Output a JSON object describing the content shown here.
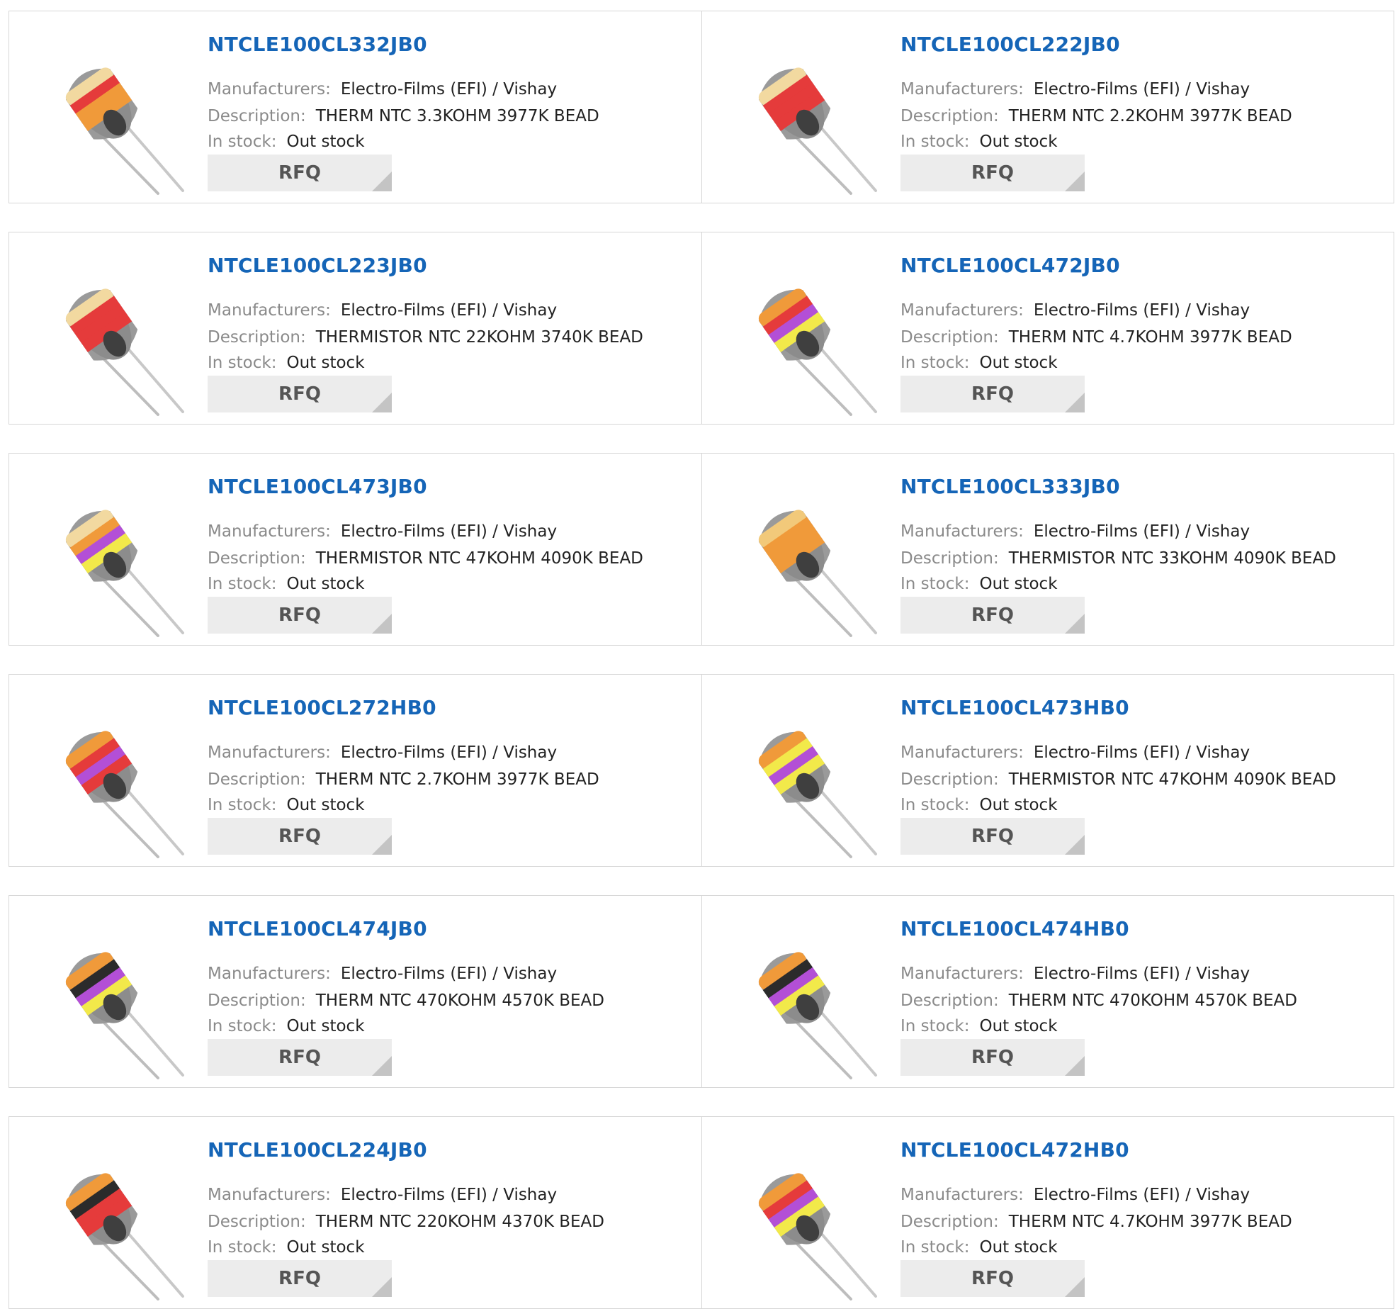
{
  "labels": {
    "manufacturers": "Manufacturers:",
    "description": "Description:",
    "in_stock": "In stock:",
    "rfq": "RFQ"
  },
  "colors": {
    "title_link": "#1565b7",
    "border": "#d6d6d6",
    "rfq_bg": "#ececec"
  },
  "products": [
    {
      "part": "NTCLE100CL332JB0",
      "manufacturer": "Electro-Films (EFI) / Vishay",
      "description": "THERM NTC 3.3KOHM 3977K BEAD",
      "stock": "Out stock",
      "bands": [
        "#f2d9a0",
        "#e53b3b",
        "#f09a3a",
        "#f09a3a"
      ]
    },
    {
      "part": "NTCLE100CL222JB0",
      "manufacturer": "Electro-Films (EFI) / Vishay",
      "description": "THERM NTC 2.2KOHM 3977K BEAD",
      "stock": "Out stock",
      "bands": [
        "#f2d9a0",
        "#e53b3b",
        "#e53b3b",
        "#e53b3b"
      ]
    },
    {
      "part": "NTCLE100CL223JB0",
      "manufacturer": "Electro-Films (EFI) / Vishay",
      "description": "THERMISTOR NTC 22KOHM 3740K BEAD",
      "stock": "Out stock",
      "bands": [
        "#f2d9a0",
        "#e53b3b",
        "#e53b3b",
        "#e53b3b"
      ]
    },
    {
      "part": "NTCLE100CL472JB0",
      "manufacturer": "Electro-Films (EFI) / Vishay",
      "description": "THERM NTC 4.7KOHM 3977K BEAD",
      "stock": "Out stock",
      "bands": [
        "#f09a3a",
        "#e53b3b",
        "#b34fd6",
        "#f2e94a"
      ]
    },
    {
      "part": "NTCLE100CL473JB0",
      "manufacturer": "Electro-Films (EFI) / Vishay",
      "description": "THERMISTOR NTC 47KOHM 4090K BEAD",
      "stock": "Out stock",
      "bands": [
        "#f2d9a0",
        "#f09a3a",
        "#b34fd6",
        "#f2e94a"
      ]
    },
    {
      "part": "NTCLE100CL333JB0",
      "manufacturer": "Electro-Films (EFI) / Vishay",
      "description": "THERMISTOR NTC 33KOHM 4090K BEAD",
      "stock": "Out stock",
      "bands": [
        "#f2c97a",
        "#f09a3a",
        "#f09a3a",
        "#f09a3a"
      ]
    },
    {
      "part": "NTCLE100CL272HB0",
      "manufacturer": "Electro-Films (EFI) / Vishay",
      "description": "THERM NTC 2.7KOHM 3977K BEAD",
      "stock": "Out stock",
      "bands": [
        "#f09a3a",
        "#e53b3b",
        "#b34fd6",
        "#e53b3b"
      ]
    },
    {
      "part": "NTCLE100CL473HB0",
      "manufacturer": "Electro-Films (EFI) / Vishay",
      "description": "THERMISTOR NTC 47KOHM 4090K BEAD",
      "stock": "Out stock",
      "bands": [
        "#f09a3a",
        "#f2e94a",
        "#b34fd6",
        "#f2e94a"
      ]
    },
    {
      "part": "NTCLE100CL474JB0",
      "manufacturer": "Electro-Films (EFI) / Vishay",
      "description": "THERM NTC 470KOHM 4570K BEAD",
      "stock": "Out stock",
      "bands": [
        "#f09a3a",
        "#2b2b2b",
        "#b34fd6",
        "#f2e94a"
      ]
    },
    {
      "part": "NTCLE100CL474HB0",
      "manufacturer": "Electro-Films (EFI) / Vishay",
      "description": "THERM NTC 470KOHM 4570K BEAD",
      "stock": "Out stock",
      "bands": [
        "#f09a3a",
        "#2b2b2b",
        "#b34fd6",
        "#f2e94a"
      ]
    },
    {
      "part": "NTCLE100CL224JB0",
      "manufacturer": "Electro-Films (EFI) / Vishay",
      "description": "THERM NTC 220KOHM 4370K BEAD",
      "stock": "Out stock",
      "bands": [
        "#f09a3a",
        "#2b2b2b",
        "#e53b3b",
        "#e53b3b"
      ]
    },
    {
      "part": "NTCLE100CL472HB0",
      "manufacturer": "Electro-Films (EFI) / Vishay",
      "description": "THERM NTC 4.7KOHM 3977K BEAD",
      "stock": "Out stock",
      "bands": [
        "#f09a3a",
        "#e53b3b",
        "#b34fd6",
        "#f2e94a"
      ]
    }
  ]
}
